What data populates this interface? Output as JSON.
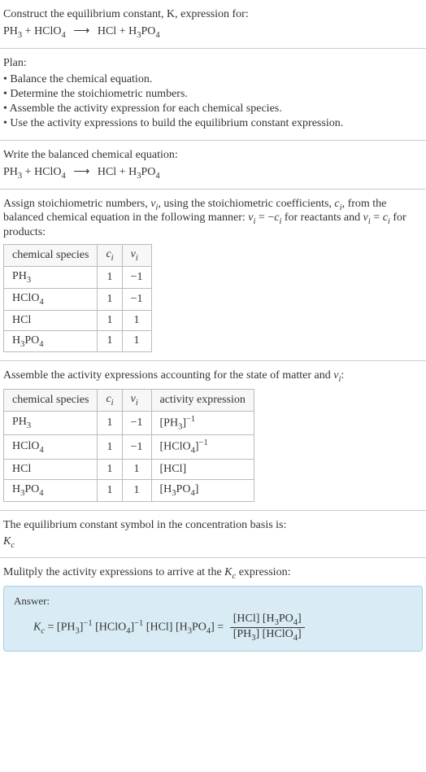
{
  "prompt": {
    "line1": "Construct the equilibrium constant, K, expression for:",
    "eq_lhs_a": "PH",
    "eq_lhs_a_sub": "3",
    "plus": " + ",
    "eq_lhs_b": "HClO",
    "eq_lhs_b_sub": "4",
    "arrow": "⟶",
    "eq_rhs_a": "HCl",
    "eq_rhs_b": "H",
    "eq_rhs_b_sub": "3",
    "eq_rhs_c": "PO",
    "eq_rhs_c_sub": "4"
  },
  "plan": {
    "title": "Plan:",
    "items": [
      "• Balance the chemical equation.",
      "• Determine the stoichiometric numbers.",
      "• Assemble the activity expression for each chemical species.",
      "• Use the activity expressions to build the equilibrium constant expression."
    ]
  },
  "balanced": {
    "title": "Write the balanced chemical equation:"
  },
  "stoich": {
    "intro_a": "Assign stoichiometric numbers, ",
    "nu": "ν",
    "nu_sub": "i",
    "intro_b": ", using the stoichiometric coefficients, ",
    "c": "c",
    "c_sub": "i",
    "intro_c": ", from the balanced chemical equation in the following manner: ",
    "rel1_a": "ν",
    "rel1_b": " = −",
    "rel1_c": "c",
    "intro_d": " for reactants and ",
    "rel2_a": "ν",
    "rel2_b": " = ",
    "rel2_c": "c",
    "intro_e": " for products:",
    "headers": [
      "chemical species",
      "c",
      "ν"
    ],
    "header_sub": "i",
    "rows": [
      {
        "sp_a": "PH",
        "sp_a_sub": "3",
        "sp_b": "",
        "sp_b_sub": "",
        "c": "1",
        "nu": "−1"
      },
      {
        "sp_a": "HClO",
        "sp_a_sub": "4",
        "sp_b": "",
        "sp_b_sub": "",
        "c": "1",
        "nu": "−1"
      },
      {
        "sp_a": "HCl",
        "sp_a_sub": "",
        "sp_b": "",
        "sp_b_sub": "",
        "c": "1",
        "nu": "1"
      },
      {
        "sp_a": "H",
        "sp_a_sub": "3",
        "sp_b": "PO",
        "sp_b_sub": "4",
        "c": "1",
        "nu": "1"
      }
    ]
  },
  "activity": {
    "intro_a": "Assemble the activity expressions accounting for the state of matter and ",
    "nu": "ν",
    "nu_sub": "i",
    "intro_b": ":",
    "headers": [
      "chemical species",
      "c",
      "ν",
      "activity expression"
    ],
    "header_sub": "i",
    "rows": [
      {
        "sp_a": "PH",
        "sp_a_sub": "3",
        "sp_b": "",
        "sp_b_sub": "",
        "c": "1",
        "nu": "−1",
        "act_a": "[PH",
        "act_a_sub": "3",
        "act_b": "]",
        "act_exp": "−1",
        "act_c": "",
        "act_c_sub": ""
      },
      {
        "sp_a": "HClO",
        "sp_a_sub": "4",
        "sp_b": "",
        "sp_b_sub": "",
        "c": "1",
        "nu": "−1",
        "act_a": "[HClO",
        "act_a_sub": "4",
        "act_b": "]",
        "act_exp": "−1",
        "act_c": "",
        "act_c_sub": ""
      },
      {
        "sp_a": "HCl",
        "sp_a_sub": "",
        "sp_b": "",
        "sp_b_sub": "",
        "c": "1",
        "nu": "1",
        "act_a": "[HCl]",
        "act_a_sub": "",
        "act_b": "",
        "act_exp": "",
        "act_c": "",
        "act_c_sub": ""
      },
      {
        "sp_a": "H",
        "sp_a_sub": "3",
        "sp_b": "PO",
        "sp_b_sub": "4",
        "c": "1",
        "nu": "1",
        "act_a": "[H",
        "act_a_sub": "3",
        "act_b": "PO",
        "act_exp": "",
        "act_c": "",
        "act_c_sub": "4",
        "act_d": "]"
      }
    ]
  },
  "kcsymbol": {
    "line": "The equilibrium constant symbol in the concentration basis is:",
    "k": "K",
    "k_sub": "c"
  },
  "multiply": {
    "line_a": "Mulitply the activity expressions to arrive at the ",
    "k": "K",
    "k_sub": "c",
    "line_b": " expression:"
  },
  "answer": {
    "label": "Answer:",
    "k": "K",
    "k_sub": "c",
    "eq": " = ",
    "t1": "[PH",
    "t1_sub": "3",
    "t1_exp": "−1",
    "t2": " [HClO",
    "t2_sub": "4",
    "t2_exp": "−1",
    "t3": " [HCl] [H",
    "t3_sub": "3",
    "t4": "PO",
    "t4_sub": "4",
    "t5": "] = ",
    "num_a": "[HCl] [H",
    "num_a_sub": "3",
    "num_b": "PO",
    "num_b_sub": "4",
    "num_c": "]",
    "den_a": "[PH",
    "den_a_sub": "3",
    "den_b": "] [HClO",
    "den_b_sub": "4",
    "den_c": "]"
  }
}
